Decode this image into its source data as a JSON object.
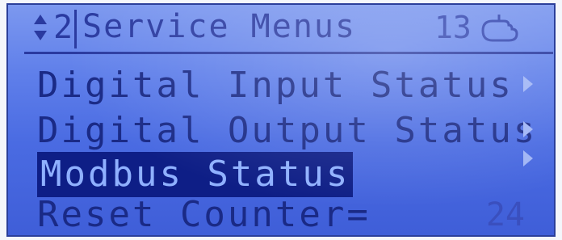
{
  "header": {
    "page_number": "2",
    "title": "Service Menus",
    "count": "13",
    "nav_icon": "up-down-arrows-icon",
    "status_icon": "hand-pointer-icon"
  },
  "menu": {
    "items": [
      {
        "label": "Digital Input Status",
        "arrow_icon": "arrow-right-icon"
      },
      {
        "label": "Digital Output Status",
        "arrow_icon": "arrow-right-icon"
      },
      {
        "label": "Modbus Status",
        "selected": true,
        "arrow_icon": "arrow-right-icon"
      },
      {
        "label": "Reset Counter=",
        "value": "24"
      }
    ]
  },
  "colors": {
    "lcd_background": "#5f7fea",
    "text": "#1a2a86",
    "selection_background": "#0e1e86",
    "selection_text": "#8fb0ff"
  }
}
